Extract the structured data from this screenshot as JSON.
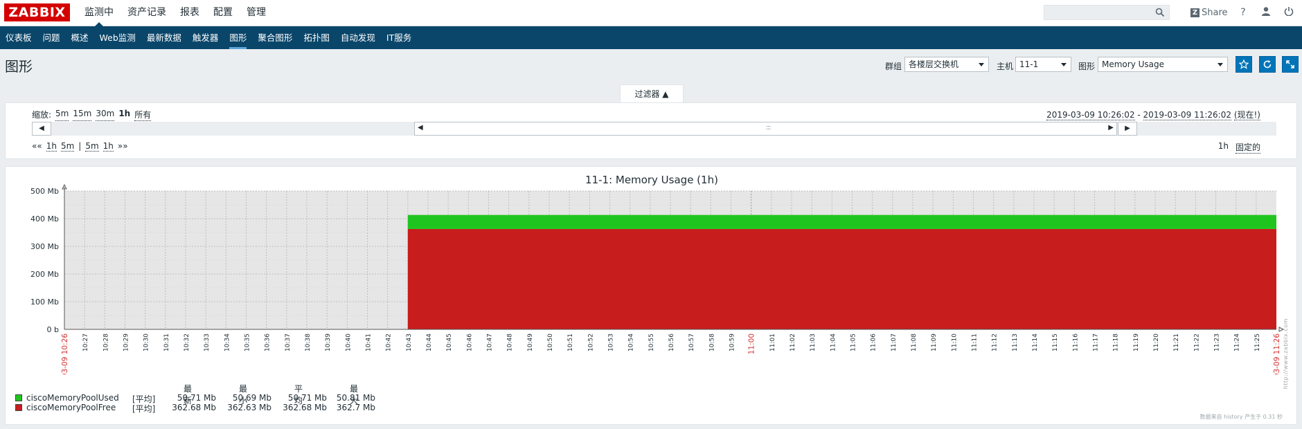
{
  "logo": "ZABBIX",
  "main_menu": [
    "监测中",
    "资产记录",
    "报表",
    "配置",
    "管理"
  ],
  "header_tools": {
    "share": "Share",
    "help": "?",
    "user": "user",
    "logout": "power"
  },
  "sub_menu": [
    "仪表板",
    "问题",
    "概述",
    "Web监测",
    "最新数据",
    "触发器",
    "图形",
    "聚合图形",
    "拓扑图",
    "自动发现",
    "IT服务"
  ],
  "page_title": "图形",
  "filters": {
    "group_label": "群组",
    "group_value": "各楼层交换机",
    "host_label": "主机",
    "host_value": "11-1",
    "graph_label": "图形",
    "graph_value": "Memory Usage"
  },
  "filter_tab": "过滤器 ▲",
  "zoom": {
    "label": "缩放:",
    "options": [
      "5m",
      "15m",
      "30m",
      "1h",
      "所有"
    ],
    "selected": "1h"
  },
  "period": {
    "from": "2019-03-09 10:26:02",
    "sep": " - ",
    "to": "2019-03-09 11:26:02",
    "now": "(现在!)"
  },
  "timeline": {
    "left": "◀",
    "right": "▶",
    "handle": ":::"
  },
  "navigation": [
    "«« ",
    "1h",
    "5m",
    "|",
    "5m",
    "1h",
    " »»"
  ],
  "fixed": {
    "period": "1h",
    "label": "固定的"
  },
  "graph": {
    "title": "11-1: Memory Usage (1h)",
    "footnote": "数据来自 history 产生于 0.31 秒",
    "watermark": "http://www.zabbix.com"
  },
  "chart_data": {
    "type": "area",
    "title": "11-1: Memory Usage (1h)",
    "ylim": [
      0,
      500
    ],
    "y_ticks": [
      "0 b",
      "100 Mb",
      "200 Mb",
      "300 Mb",
      "400 Mb",
      "500 Mb"
    ],
    "x_start_label": "03-09 10:26",
    "x_end_label": "03-09 11:26",
    "x_ticks": [
      "10:27",
      "10:28",
      "10:29",
      "10:30",
      "10:31",
      "10:32",
      "10:33",
      "10:34",
      "10:35",
      "10:36",
      "10:37",
      "10:38",
      "10:39",
      "10:40",
      "10:41",
      "10:42",
      "10:43",
      "10:44",
      "10:45",
      "10:46",
      "10:47",
      "10:48",
      "10:49",
      "10:50",
      "10:51",
      "10:52",
      "10:53",
      "10:54",
      "10:55",
      "10:56",
      "10:57",
      "10:58",
      "10:59",
      "11:00",
      "11:01",
      "11:02",
      "11:03",
      "11:04",
      "11:05",
      "11:06",
      "11:07",
      "11:08",
      "11:09",
      "11:10",
      "11:11",
      "11:12",
      "11:13",
      "11:14",
      "11:15",
      "11:16",
      "11:17",
      "11:18",
      "11:19",
      "11:20",
      "11:21",
      "11:22",
      "11:23",
      "11:24",
      "11:25"
    ],
    "stacked": true,
    "data_start": "10:43",
    "series": [
      {
        "name": "ciscoMemoryPoolFree",
        "color": "#c81d1d",
        "func": "[平均]",
        "last": "362.68 Mb",
        "min": "362.63 Mb",
        "avg": "362.68 Mb",
        "max": "362.7 Mb",
        "value": 362.68
      },
      {
        "name": "ciscoMemoryPoolUsed",
        "color": "#1fc51f",
        "func": "[平均]",
        "last": "50.71 Mb",
        "min": "50.69 Mb",
        "avg": "50.71 Mb",
        "max": "50.81 Mb",
        "value": 50.71
      }
    ],
    "legend_headers": {
      "last": "最新",
      "min": "最小",
      "avg": "平均",
      "max": "最大"
    },
    "grid": true
  }
}
